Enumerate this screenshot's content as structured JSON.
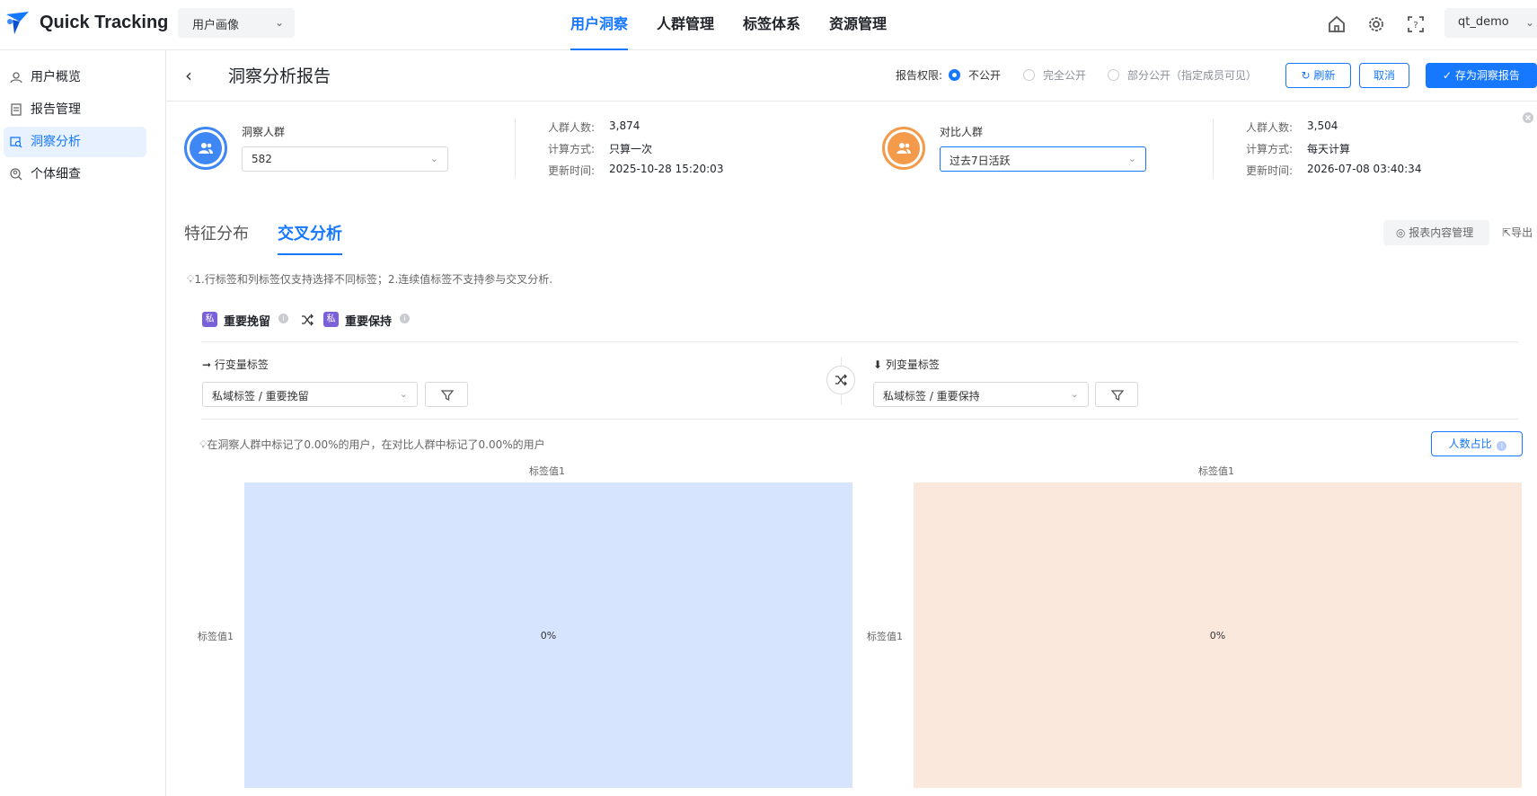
{
  "app": {
    "name": "Quick Tracking",
    "app_select": "用户画像",
    "nav": [
      "用户洞察",
      "人群管理",
      "标签体系",
      "资源管理"
    ],
    "user": "qt_demo"
  },
  "sidebar": {
    "items": [
      {
        "label": "用户概览",
        "icon": "user-overview-icon"
      },
      {
        "label": "报告管理",
        "icon": "report-icon"
      },
      {
        "label": "洞察分析",
        "icon": "insight-analysis-icon"
      },
      {
        "label": "个体细查",
        "icon": "individual-icon"
      }
    ]
  },
  "header": {
    "title": "洞察分析报告",
    "permission_label": "报告权限:",
    "permission_options": [
      "不公开",
      "完全公开",
      "部分公开（指定成员可见）"
    ],
    "permission_selected": "不公开",
    "refresh": "刷新",
    "cancel": "取消",
    "save": "存为洞察报告"
  },
  "insight_crowd": {
    "label": "洞察人群",
    "value": "582",
    "meta": [
      {
        "k": "人群人数:",
        "v": "3,874"
      },
      {
        "k": "计算方式:",
        "v": "只算一次"
      },
      {
        "k": "更新时间:",
        "v": "2025-10-28 15:20:03"
      }
    ]
  },
  "compare_crowd": {
    "label": "对比人群",
    "value": "过去7日活跃",
    "meta": [
      {
        "k": "人群人数:",
        "v": "3,504"
      },
      {
        "k": "计算方式:",
        "v": "每天计算"
      },
      {
        "k": "更新时间:",
        "v": "2026-07-08 03:40:34"
      }
    ]
  },
  "tabs": [
    "特征分布",
    "交叉分析"
  ],
  "tools": {
    "content_manage": "报表内容管理",
    "export": "导出"
  },
  "tip": "1.行标签和列标签仅支持选择不同标签；2.连续值标签不支持参与交叉分析.",
  "tag_pair": {
    "chip": "私",
    "left": "重要挽留",
    "right": "重要保持"
  },
  "row_var": {
    "label": "行变量标签",
    "value": "私域标签 / 重要挽留"
  },
  "col_var": {
    "label": "列变量标签",
    "value": "私域标签 / 重要保持"
  },
  "summary": "在洞察人群中标记了0.00%的用户，在对比人群中标记了0.00%的用户",
  "ratio_button": "人数占比",
  "heatmaps": [
    {
      "col": "标签值1",
      "row": "标签值1",
      "value": "0%",
      "color": "#d6e4fd"
    },
    {
      "col": "标签值1",
      "row": "标签值1",
      "value": "0%",
      "color": "#fae8dd"
    }
  ],
  "colors": {
    "accent": "#1677ff",
    "insight": "#3e87f5",
    "compare": "#f39a4b",
    "tag_chip": "#7b61d9"
  }
}
